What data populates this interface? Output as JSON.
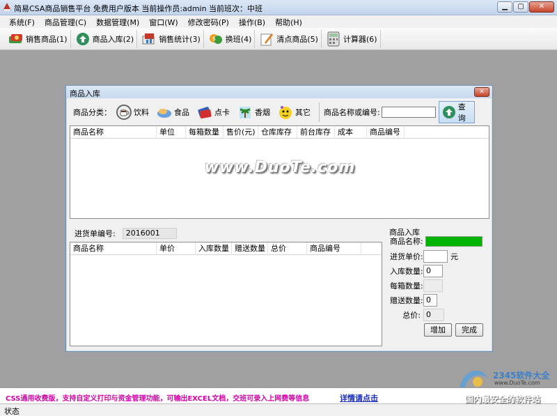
{
  "window": {
    "title": "简易CSA商品销售平台 免费用户版本 当前操作员:admin 当前班次：中班",
    "min": "▭",
    "max": "□",
    "close": "✕"
  },
  "menu": [
    "系统(F)",
    "商品管理(C)",
    "数据管理(M)",
    "窗口(W)",
    "修改密码(P)",
    "操作(B)",
    "帮助(H)"
  ],
  "toolbar": [
    {
      "label": "销售商品(1)",
      "icon": "cash-icon"
    },
    {
      "label": "商品入库(2)",
      "icon": "stock-in-icon"
    },
    {
      "label": "销售统计(3)",
      "icon": "stats-icon"
    },
    {
      "label": "换班(4)",
      "icon": "shift-icon"
    },
    {
      "label": "清点商品(5)",
      "icon": "inventory-icon"
    },
    {
      "label": "计算器(6)",
      "icon": "calculator-icon"
    }
  ],
  "dialog": {
    "title": "商品入库",
    "category_label": "商品分类：",
    "categories": [
      "饮料",
      "食品",
      "点卡",
      "香烟",
      "其它"
    ],
    "search_label": "商品名称或编号:",
    "search_value": "",
    "query_label": "查询",
    "top_columns": [
      "商品名称",
      "单位",
      "每箱数量",
      "售价(元)",
      "仓库库存",
      "前台库存",
      "成本",
      "商品编号"
    ],
    "order_label": "进货单编号:",
    "order_value": "2016001",
    "bottom_columns": [
      "商品名称",
      "单价",
      "入库数量",
      "赠送数量",
      "总价",
      "商品编号"
    ],
    "side": {
      "title": "商品入库",
      "name_label": "商品名称:",
      "price_label": "进货单价:",
      "price_value": "",
      "price_unit": "元",
      "qty_label": "入库数量:",
      "qty_value": "0",
      "per_box_label": "每箱数量:",
      "per_box_value": "",
      "gift_label": "赠送数量:",
      "gift_value": "0",
      "total_label": "总价:",
      "total_value": "0",
      "add_button": "增加",
      "done_button": "完成"
    },
    "watermark": "www.DuoTe.com"
  },
  "ad": {
    "text": "CSS通用收费版，支持自定义打印与资金管理功能，可输出EXCEL文档，交班可录入上网费等信息",
    "link": "详情请点击"
  },
  "status": "状态",
  "site_watermark": {
    "name": "2345软件大全",
    "url": "www.DuoTe.com",
    "slogan": "国内最安全的软件站"
  }
}
